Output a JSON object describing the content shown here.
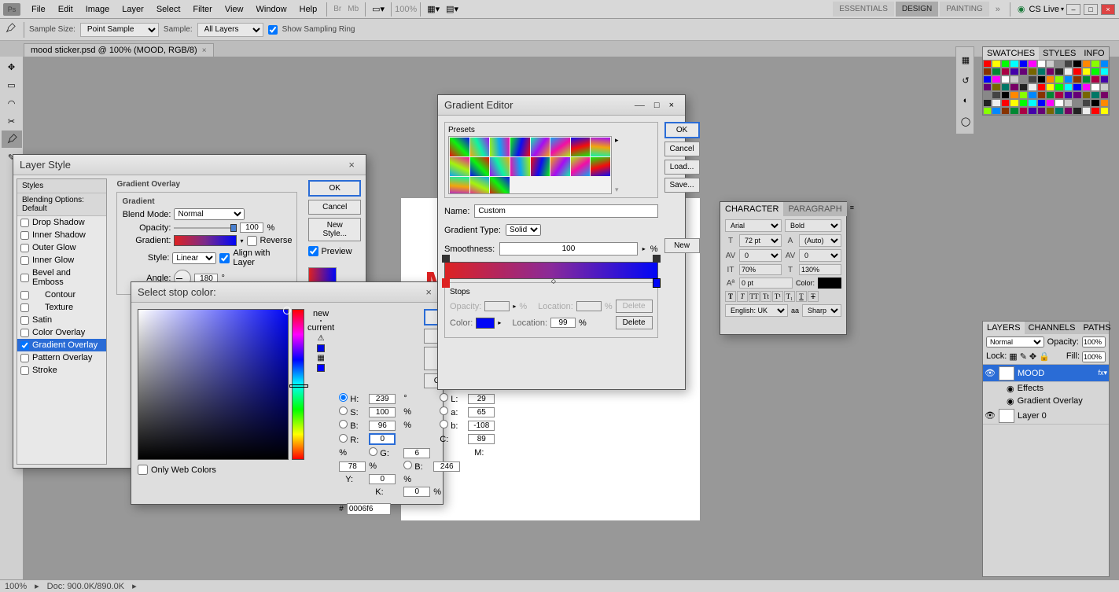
{
  "menu": {
    "items": [
      "File",
      "Edit",
      "Image",
      "Layer",
      "Select",
      "Filter",
      "View",
      "Window",
      "Help"
    ],
    "zoom": "100%",
    "workspace_tabs": [
      "ESSENTIALS",
      "DESIGN",
      "PAINTING"
    ],
    "cslive": "CS Live"
  },
  "options": {
    "sample_size_label": "Sample Size:",
    "sample_size": "Point Sample",
    "sample_label": "Sample:",
    "sample": "All Layers",
    "show_sampling": "Show Sampling Ring"
  },
  "doctab": {
    "title": "mood sticker.psd @ 100% (MOOD, RGB/8)"
  },
  "canvas": {
    "text": "M"
  },
  "layer_style": {
    "title": "Layer Style",
    "styles_header": "Styles",
    "blending_header": "Blending Options: Default",
    "items": [
      "Drop Shadow",
      "Inner Shadow",
      "Outer Glow",
      "Inner Glow",
      "Bevel and Emboss",
      "Contour",
      "Texture",
      "Satin",
      "Color Overlay",
      "Gradient Overlay",
      "Pattern Overlay",
      "Stroke"
    ],
    "selected": "Gradient Overlay",
    "checked": [
      "Gradient Overlay"
    ],
    "section": "Gradient Overlay",
    "subsection": "Gradient",
    "blend_mode_label": "Blend Mode:",
    "blend_mode": "Normal",
    "opacity_label": "Opacity:",
    "opacity": "100",
    "gradient_label": "Gradient:",
    "reverse": "Reverse",
    "style_label": "Style:",
    "style": "Linear",
    "align": "Align with Layer",
    "angle_label": "Angle:",
    "angle": "180",
    "ok": "OK",
    "cancel": "Cancel",
    "new_style": "New Style...",
    "preview": "Preview"
  },
  "color_picker": {
    "title": "Select stop color:",
    "new": "new",
    "current": "current",
    "ok": "OK",
    "cancel": "Cancel",
    "add_swatches": "Add To Swatches",
    "color_libs": "Color Libraries",
    "H": "239",
    "S": "100",
    "B": "96",
    "L": "29",
    "a": "65",
    "b": "-108",
    "R": "0",
    "G": "6",
    "Bblue": "246",
    "C": "89",
    "M": "78",
    "Y": "0",
    "K": "0",
    "hex": "0006f6",
    "only_web": "Only Web Colors"
  },
  "grad_editor": {
    "title": "Gradient Editor",
    "presets": "Presets",
    "name_label": "Name:",
    "name": "Custom",
    "type_label": "Gradient Type:",
    "type": "Solid",
    "smooth_label": "Smoothness:",
    "smooth": "100",
    "stops": "Stops",
    "opacity_label": "Opacity:",
    "location_label": "Location:",
    "color_label": "Color:",
    "location2": "99",
    "delete": "Delete",
    "ok": "OK",
    "cancel": "Cancel",
    "load": "Load...",
    "save": "Save...",
    "new": "New"
  },
  "character": {
    "tab1": "CHARACTER",
    "tab2": "PARAGRAPH",
    "font": "Arial",
    "weight": "Bold",
    "size": "72 pt",
    "leading": "(Auto)",
    "kerning": "0",
    "tracking": "0",
    "vscale": "70%",
    "hscale": "130%",
    "baseline": "0 pt",
    "color_label": "Color:",
    "lang": "English: UK",
    "aa_label": "aa",
    "aa": "Sharp"
  },
  "swatches": {
    "tab1": "SWATCHES",
    "tab2": "STYLES",
    "tab3": "INFO"
  },
  "layers": {
    "tab1": "LAYERS",
    "tab2": "CHANNELS",
    "tab3": "PATHS",
    "blend": "Normal",
    "opacity_lbl": "Opacity:",
    "opacity": "100%",
    "lock_lbl": "Lock:",
    "fill_lbl": "Fill:",
    "fill": "100%",
    "items": [
      {
        "name": "MOOD",
        "type": "T",
        "selected": true
      },
      {
        "name": "Effects",
        "sub": true
      },
      {
        "name": "Gradient Overlay",
        "sub": true
      },
      {
        "name": "Layer 0",
        "type": "",
        "selected": false
      }
    ]
  },
  "status": {
    "zoom": "100%",
    "doc": "Doc: 900.0K/890.0K"
  },
  "chevrons": "»"
}
